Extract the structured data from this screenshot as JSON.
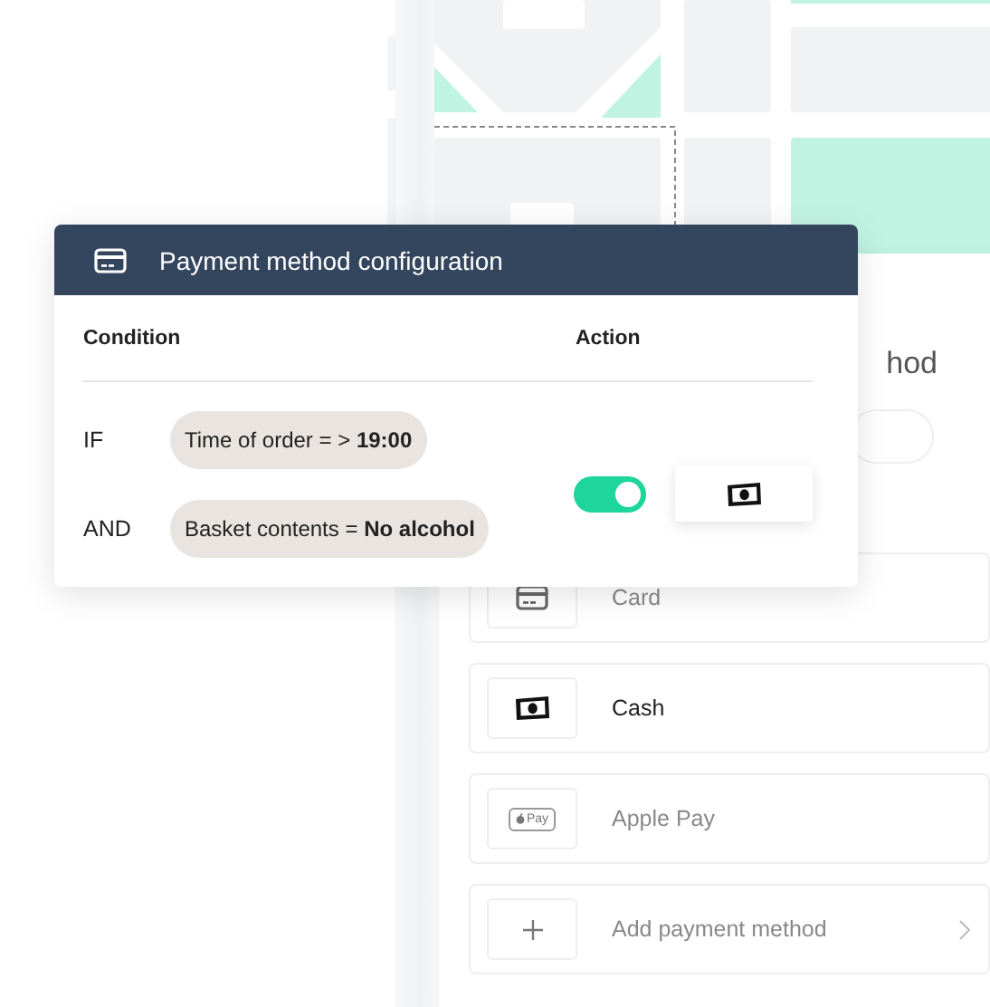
{
  "dialog": {
    "title": "Payment method configuration",
    "columns": [
      "Condition",
      "Action"
    ],
    "conditions": [
      {
        "operator": "IF",
        "text": "Time of order = >",
        "value": "19:00"
      },
      {
        "operator": "AND",
        "text": "Basket contents =",
        "value": "No alcohol"
      }
    ],
    "action": {
      "on": true
    }
  },
  "sheet": {
    "title": "hod",
    "methods": [
      {
        "kind": "card",
        "label": "Card",
        "selected": false
      },
      {
        "kind": "cash",
        "label": "Cash",
        "selected": true
      },
      {
        "kind": "applepay",
        "label": "Apple Pay",
        "badge": "Pay",
        "selected": false
      },
      {
        "kind": "add",
        "label": "Add payment method",
        "selected": false
      }
    ]
  }
}
